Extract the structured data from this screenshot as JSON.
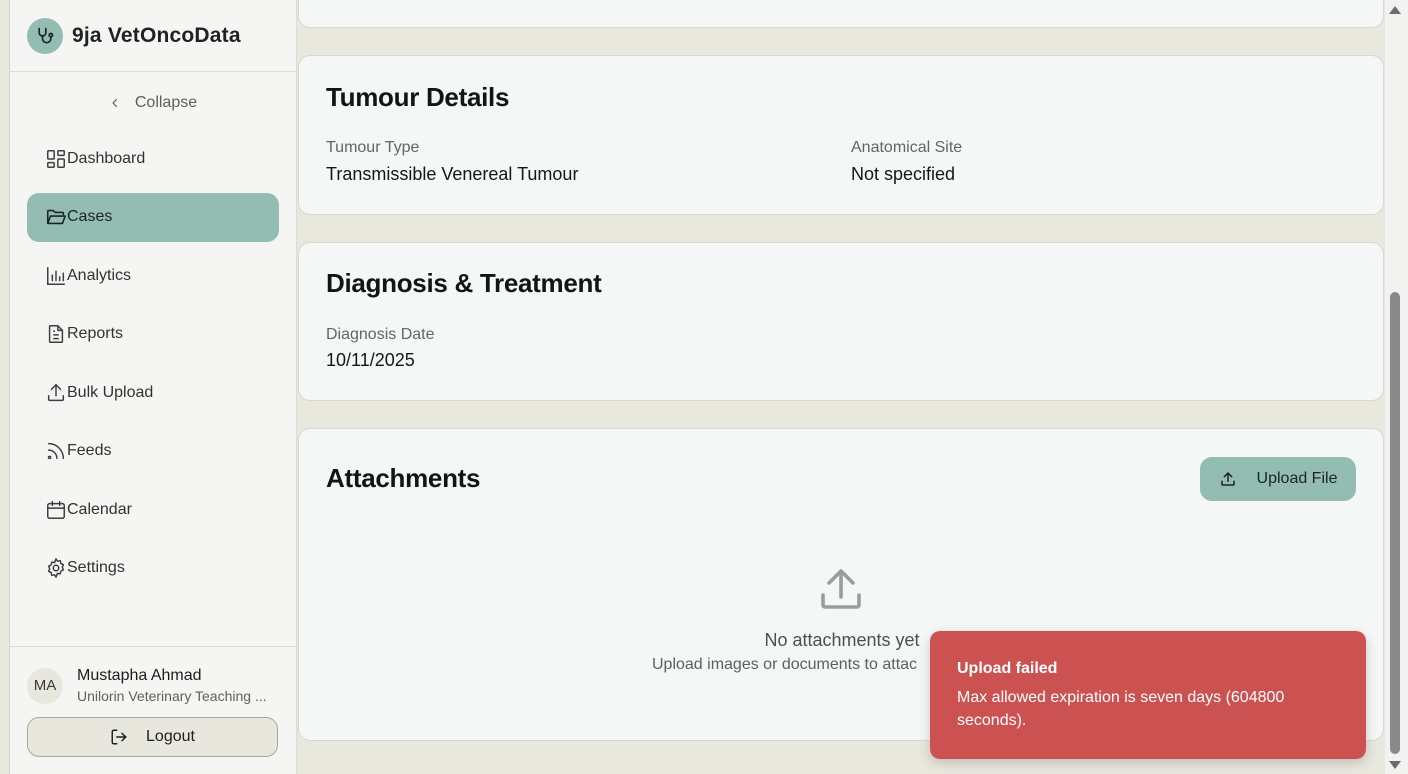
{
  "brand": {
    "name": "9ja VetOncoData"
  },
  "sidebar": {
    "collapse_label": "Collapse",
    "items": [
      {
        "label": "Dashboard",
        "icon": "dashboard-icon"
      },
      {
        "label": "Cases",
        "icon": "folder-open-icon",
        "active": true
      },
      {
        "label": "Analytics",
        "icon": "bar-chart-icon"
      },
      {
        "label": "Reports",
        "icon": "document-icon"
      },
      {
        "label": "Bulk Upload",
        "icon": "upload-icon"
      },
      {
        "label": "Feeds",
        "icon": "rss-icon"
      },
      {
        "label": "Calendar",
        "icon": "calendar-icon"
      },
      {
        "label": "Settings",
        "icon": "gear-icon"
      }
    ]
  },
  "user": {
    "initials": "MA",
    "name": "Mustapha Ahmad",
    "org": "Unilorin Veterinary Teaching ...",
    "logout_label": "Logout"
  },
  "tumour": {
    "title": "Tumour Details",
    "type_label": "Tumour Type",
    "type_value": "Transmissible Venereal Tumour",
    "site_label": "Anatomical Site",
    "site_value": "Not specified"
  },
  "diagnosis": {
    "title": "Diagnosis & Treatment",
    "date_label": "Diagnosis Date",
    "date_value": "10/11/2025"
  },
  "attachments": {
    "title": "Attachments",
    "upload_label": "Upload File",
    "empty_title": "No attachments yet",
    "empty_sub": "Upload images or documents to attac"
  },
  "toast": {
    "title": "Upload failed",
    "message": "Max allowed expiration is seven days (604800 seconds)."
  },
  "colors": {
    "accent": "#93bdb2",
    "error": "#cc5151",
    "background": "#e9e8df"
  }
}
